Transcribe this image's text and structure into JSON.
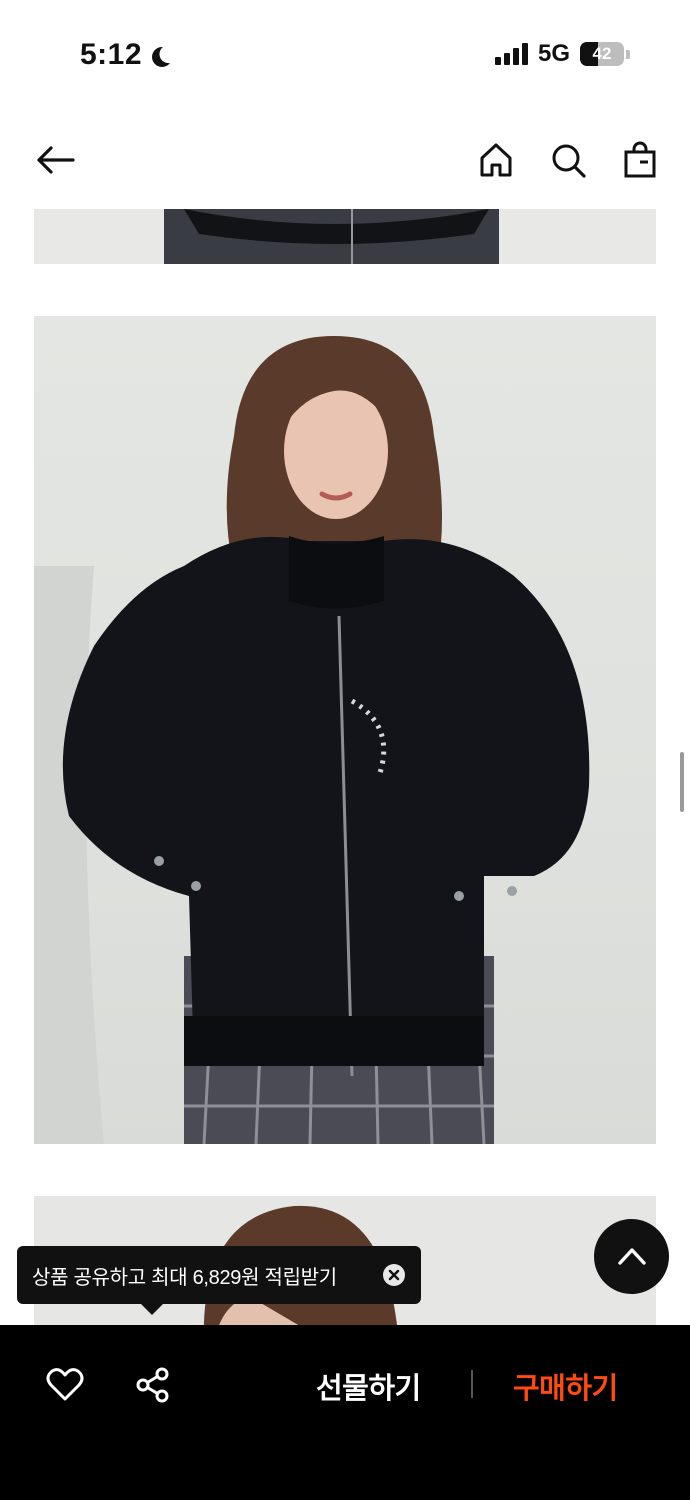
{
  "status_bar": {
    "time": "5:12",
    "network": "5G",
    "battery": "42",
    "battery_level": 0.42
  },
  "nav": {
    "back_icon": "arrow-left-icon",
    "home_icon": "home-icon",
    "search_icon": "search-icon",
    "bag_icon": "shopping-bag-icon"
  },
  "tooltip": {
    "text": "상품 공유하고 최대 6,829원 적립받기",
    "close_icon": "close-circle-icon"
  },
  "bottom_bar": {
    "heart_icon": "heart-icon",
    "share_icon": "share-icon",
    "gift_label": "선물하기",
    "buy_label": "구매하기",
    "buy_color": "#ff4a12"
  },
  "scroll_top_icon": "chevron-up-icon"
}
